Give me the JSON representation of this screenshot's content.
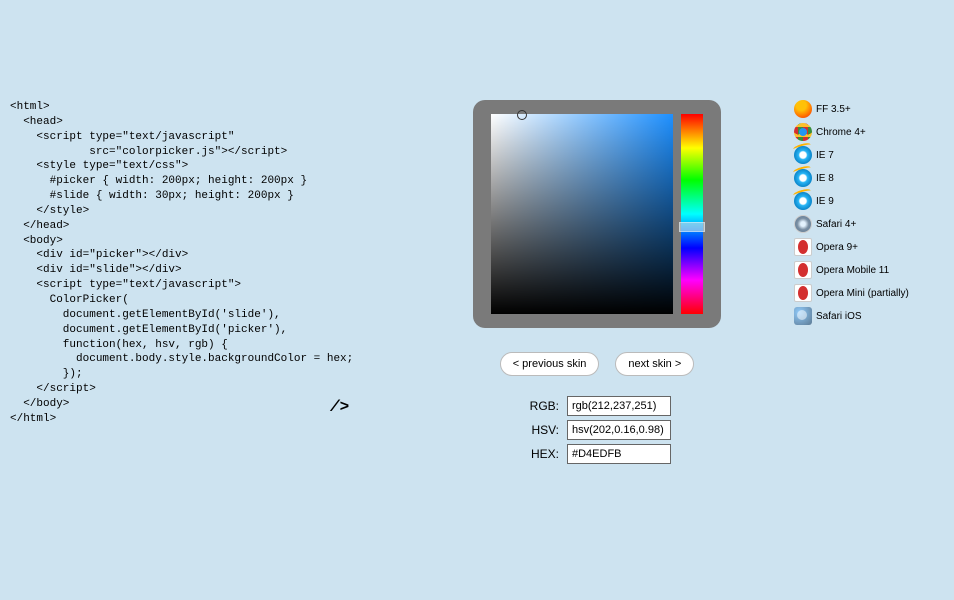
{
  "code": "<html>\n  <head>\n    <script type=\"text/javascript\"\n            src=\"colorpicker.js\"></script>\n    <style type=\"text/css\">\n      #picker { width: 200px; height: 200px }\n      #slide { width: 30px; height: 200px }\n    </style>\n  </head>\n  <body>\n    <div id=\"picker\"></div>\n    <div id=\"slide\"></div>\n    <script type=\"text/javascript\">\n      ColorPicker(\n        document.getElementById('slide'),\n        document.getElementById('picker'),\n        function(hex, hsv, rgb) {\n          document.body.style.backgroundColor = hex;\n        });\n    </script>\n  </body>\n</html>",
  "cursor": "/>",
  "buttons": {
    "prev": "< previous skin",
    "next": "next skin >"
  },
  "values": {
    "rgb_label": "RGB:",
    "rgb_value": "rgb(212,237,251)",
    "hsv_label": "HSV:",
    "hsv_value": "hsv(202,0.16,0.98)",
    "hex_label": "HEX:",
    "hex_value": "#D4EDFB"
  },
  "browsers": [
    {
      "icon": "ff-icon",
      "label": "FF 3.5+"
    },
    {
      "icon": "ch-icon",
      "label": "Chrome 4+"
    },
    {
      "icon": "ie-icon",
      "label": "IE 7"
    },
    {
      "icon": "ie-icon",
      "label": "IE 8"
    },
    {
      "icon": "ie-icon",
      "label": "IE 9"
    },
    {
      "icon": "sf-icon",
      "label": "Safari 4+"
    },
    {
      "icon": "op-icon",
      "label": "Opera 9+"
    },
    {
      "icon": "op-icon",
      "label": "Opera Mobile 11"
    },
    {
      "icon": "op-icon",
      "label": "Opera Mini (partially)"
    },
    {
      "icon": "sfios-icon",
      "label": "Safari iOS"
    }
  ]
}
